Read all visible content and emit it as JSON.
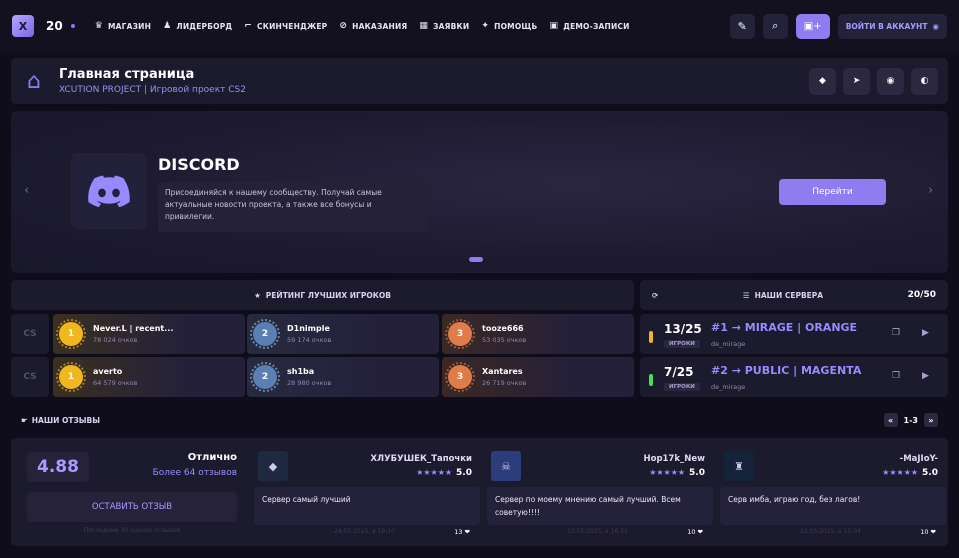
{
  "topbar": {
    "online_count": "20",
    "nav": [
      {
        "label": "МАГАЗИН",
        "icon": "♛",
        "name": "nav-shop"
      },
      {
        "label": "ЛИДЕРБОРД",
        "icon": "♟",
        "name": "nav-leaderboard"
      },
      {
        "label": "СКИНЧЕНДЖЕР",
        "icon": "⌐",
        "name": "nav-skinchanger"
      },
      {
        "label": "НАКАЗАНИЯ",
        "icon": "⊘",
        "name": "nav-punishments"
      },
      {
        "label": "ЗАЯВКИ",
        "icon": "▦",
        "name": "nav-applications"
      },
      {
        "label": "ПОМОЩЬ",
        "icon": "✦",
        "name": "nav-help"
      },
      {
        "label": "ДЕМО-ЗАПИСИ",
        "icon": "▣",
        "name": "nav-demos"
      }
    ],
    "login_label": "ВОЙТИ В АККАУНТ"
  },
  "header": {
    "title": "Главная страница",
    "subtitle": "XCUTION PROJECT | Игровой проект CS2",
    "socials": [
      "VK",
      "TG",
      "ST",
      "DS"
    ]
  },
  "banner": {
    "title": "DISCORD",
    "description": "Присоединяйся к нашему сообществу. Получай самые актуальные новости проекта, а также все бонусы и привилегии.",
    "button": "Перейти"
  },
  "rating": {
    "title": "РЕЙТИНГ ЛУЧШИХ ИГРОКОВ",
    "side_label": "CS",
    "rows": [
      [
        {
          "rank": "1",
          "name": "Never.L | recent...",
          "points": "78 024 очков"
        },
        {
          "rank": "2",
          "name": "D1nimple",
          "points": "59 174 очков"
        },
        {
          "rank": "3",
          "name": "tooze666",
          "points": "53 035 очков"
        }
      ],
      [
        {
          "rank": "1",
          "name": "averto",
          "points": "64 579 очков"
        },
        {
          "rank": "2",
          "name": "sh1ba",
          "points": "28 980 очков"
        },
        {
          "rank": "3",
          "name": "Xantares",
          "points": "26 719 очков"
        }
      ]
    ]
  },
  "servers": {
    "title": "НАШИ СЕРВЕРА",
    "count": "20/50",
    "players_label": "ИГРОКИ",
    "list": [
      {
        "players": "13/25",
        "name": "#1 → MIRAGE | ORANGE",
        "map": "de_mirage",
        "bar_color": "#f1b71f"
      },
      {
        "players": "7/25",
        "name": "#2 → PUBLIC | MAGENTA",
        "map": "de_mirage",
        "bar_color": "#4cd964"
      }
    ]
  },
  "reviews": {
    "title": "НАШИ ОТЗЫВЫ",
    "pages": "1-3",
    "score": "4.88",
    "score_word": "Отлично",
    "score_count": "Более 64 отзывов",
    "leave_button": "ОСТАВИТЬ ОТЗЫВ",
    "score_note": "Последние 30 оценок отзывов",
    "items": [
      {
        "name": "ХЛУБУШЕК_Тапочки",
        "stars": "★★★★★",
        "rating": "5.0",
        "text": "Сервер самый лучший",
        "date": "24.05.2025, в 19:10",
        "likes": "13 ❤"
      },
      {
        "name": "Hop17k_New",
        "stars": "★★★★★",
        "rating": "5.0",
        "text": "Сервер по моему мнению самый лучший. Всем советую!!!!",
        "date": "23.05.2025, в 16:11",
        "likes": "10 ❤"
      },
      {
        "name": "-MaJIoY-",
        "stars": "★★★★★",
        "rating": "5.0",
        "text": "Серв имба, играю год, без лагов!",
        "date": "22.05.2025, в 15:04",
        "likes": "10 ❤"
      }
    ]
  }
}
